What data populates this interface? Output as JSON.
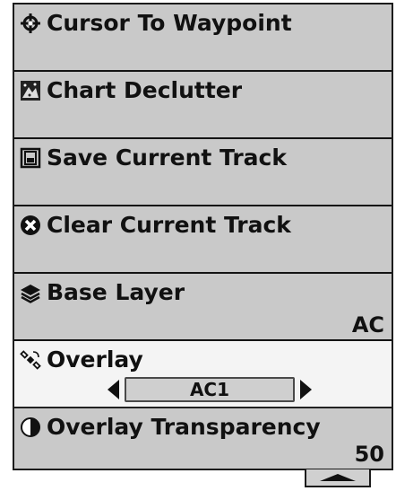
{
  "menu": {
    "items": [
      {
        "label": "Cursor To Waypoint",
        "icon": "crosshair-icon"
      },
      {
        "label": "Chart Declutter",
        "icon": "chart-declutter-icon"
      },
      {
        "label": "Save Current Track",
        "icon": "save-track-icon"
      },
      {
        "label": "Clear Current Track",
        "icon": "clear-track-icon"
      },
      {
        "label": "Base Layer",
        "icon": "layers-icon",
        "value": "AC"
      },
      {
        "label": "Overlay",
        "icon": "satellite-icon",
        "value": "AC1",
        "selected": true
      },
      {
        "label": "Overlay Transparency",
        "icon": "transparency-icon",
        "value": "50"
      }
    ]
  },
  "scroll": {
    "icon": "scroll-up-arrow-icon"
  },
  "colors": {
    "menu_bg": "#c9c9c9",
    "selected_bg": "#f4f4f4",
    "border": "#141414",
    "text": "#111111"
  }
}
